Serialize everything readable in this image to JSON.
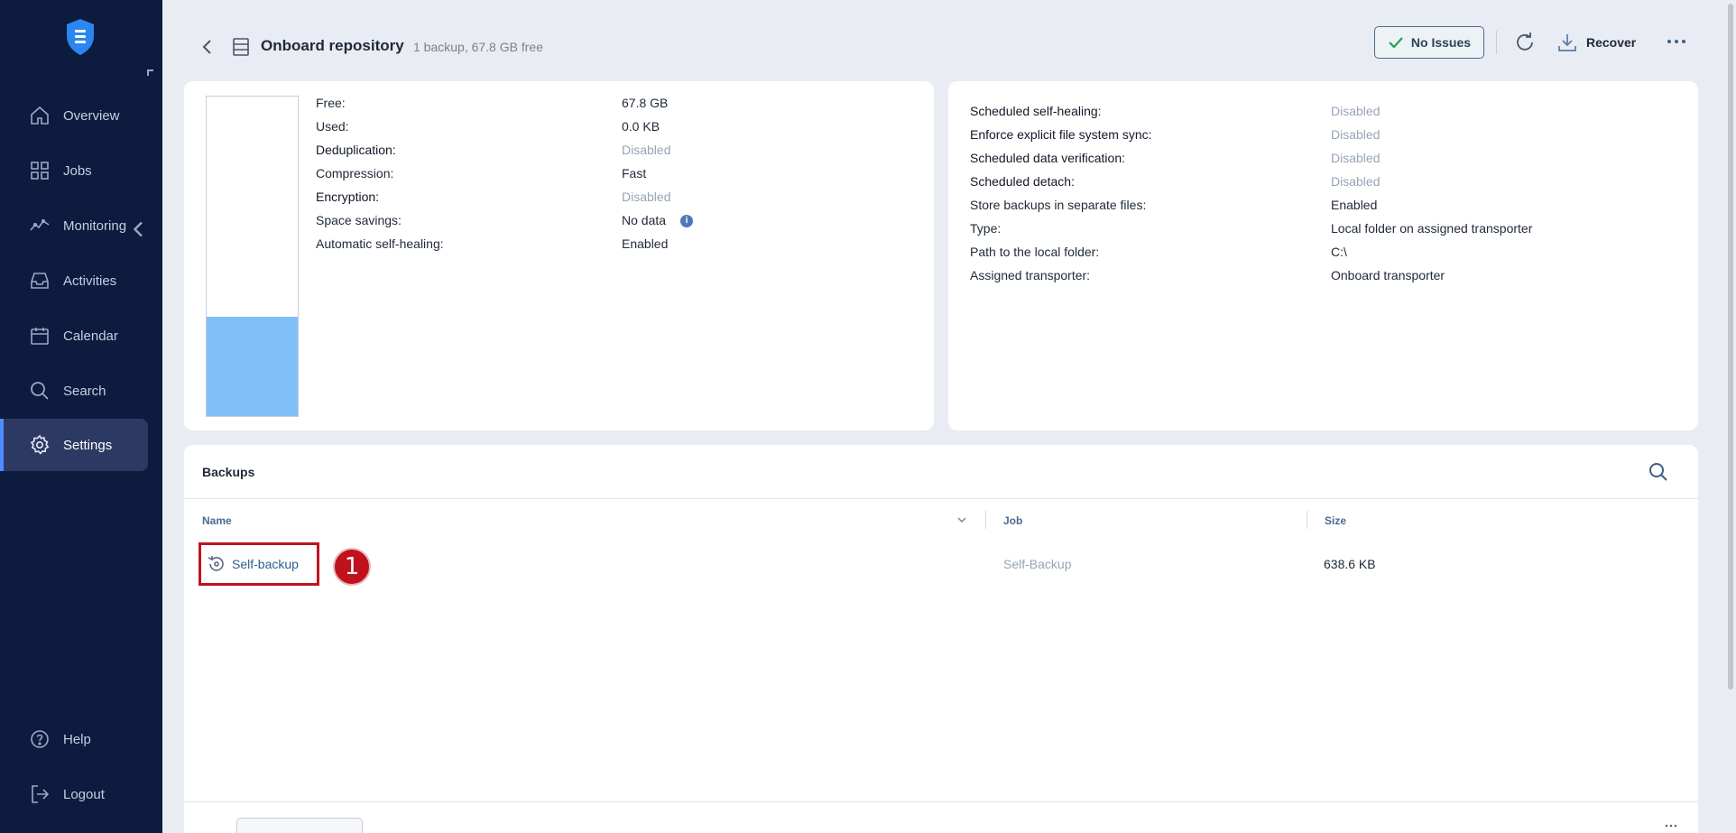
{
  "sidebar": {
    "items": [
      {
        "label": "Overview",
        "icon": "home-icon"
      },
      {
        "label": "Jobs",
        "icon": "grid-icon"
      },
      {
        "label": "Monitoring",
        "icon": "chart-line-icon"
      },
      {
        "label": "Activities",
        "icon": "inbox-icon"
      },
      {
        "label": "Calendar",
        "icon": "calendar-icon"
      },
      {
        "label": "Search",
        "icon": "search-icon"
      },
      {
        "label": "Settings",
        "icon": "gear-icon"
      }
    ],
    "bottom_items": [
      {
        "label": "Help",
        "icon": "help-icon"
      },
      {
        "label": "Logout",
        "icon": "logout-icon"
      }
    ],
    "active": "Settings"
  },
  "header": {
    "title": "Onboard repository",
    "subtitle": "1 backup, 67.8 GB free",
    "issues_label": "No Issues",
    "recover_label": "Recover"
  },
  "storage": {
    "used_fraction": 0.31,
    "properties": [
      {
        "label": "Free:",
        "value": "67.8 GB"
      },
      {
        "label": "Used:",
        "value": "0.0 KB"
      },
      {
        "label": "Deduplication:",
        "value": "Disabled"
      },
      {
        "label": "Compression:",
        "value": "Fast"
      },
      {
        "label": "Encryption:",
        "value": "Disabled"
      },
      {
        "label": "Space savings:",
        "value": "No data"
      },
      {
        "label": "Automatic self-healing:",
        "value": "Enabled"
      }
    ]
  },
  "settings": {
    "properties": [
      {
        "label": "Scheduled self-healing:",
        "value": "Disabled"
      },
      {
        "label": "Enforce explicit file system sync:",
        "value": "Disabled"
      },
      {
        "label": "Scheduled data verification:",
        "value": "Disabled"
      },
      {
        "label": "Scheduled detach:",
        "value": "Disabled"
      },
      {
        "label": "Store backups in separate files:",
        "value": "Enabled"
      },
      {
        "label": "Type:",
        "value": "Local folder on assigned transporter"
      },
      {
        "label": "Path to the local folder:",
        "value": "C:\\"
      },
      {
        "label": "Assigned transporter:",
        "value": "Onboard transporter"
      }
    ]
  },
  "backups": {
    "title": "Backups",
    "columns": {
      "name": "Name",
      "job": "Job",
      "size": "Size"
    },
    "rows": [
      {
        "name": "Self-backup",
        "job": "Self-Backup",
        "size": "638.6 KB"
      }
    ],
    "callout": "1"
  },
  "colors": {
    "sidebar_bg": "#0d1b3e",
    "accent": "#4f8cff",
    "highlight": "#c0121c",
    "gauge_fill": "#80bff8"
  }
}
